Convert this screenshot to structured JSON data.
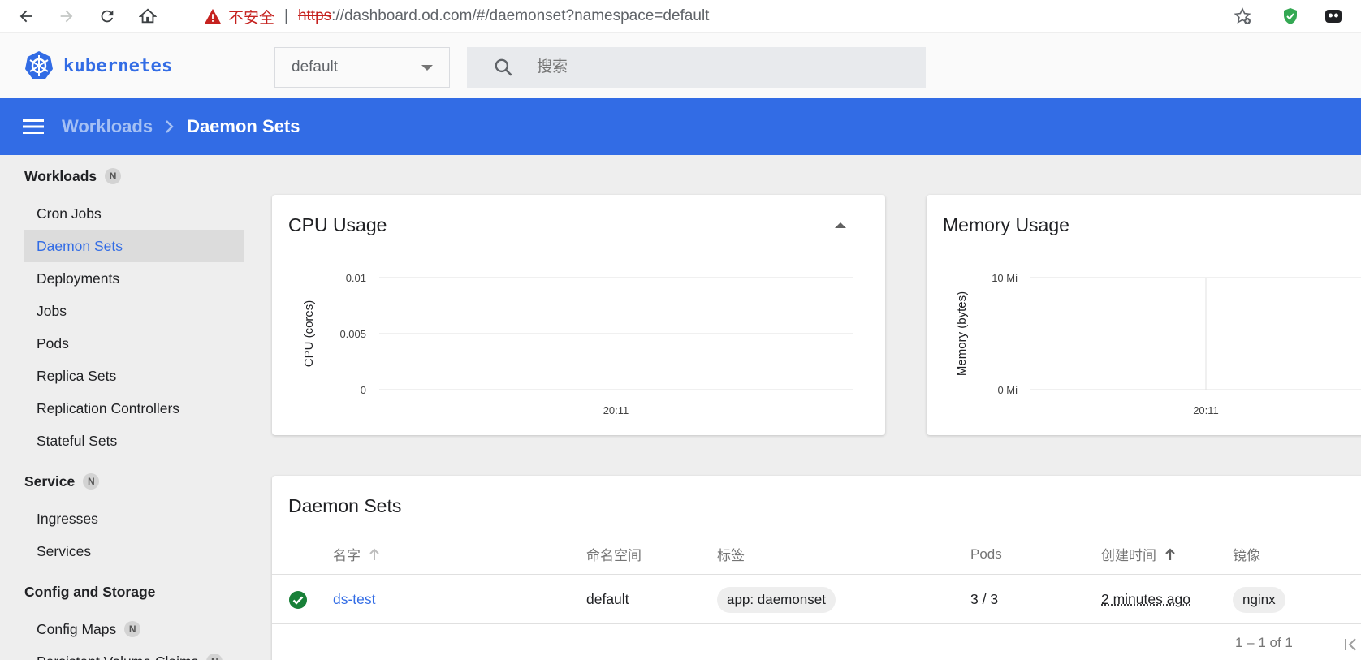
{
  "browser": {
    "security_label": "不安全",
    "url_scheme": "https",
    "url_rest": "://dashboard.od.com/#/daemonset?namespace=default"
  },
  "header": {
    "logo_text": "kubernetes",
    "namespace": "default",
    "search_placeholder": "搜索"
  },
  "toolbar": {
    "breadcrumb_parent": "Workloads",
    "breadcrumb_current": "Daemon Sets"
  },
  "sidebar": {
    "groups": [
      {
        "label": "Workloads",
        "badge": "N",
        "items": [
          "Cron Jobs",
          "Daemon Sets",
          "Deployments",
          "Jobs",
          "Pods",
          "Replica Sets",
          "Replication Controllers",
          "Stateful Sets"
        ]
      },
      {
        "label": "Service",
        "badge": "N",
        "items": [
          "Ingresses",
          "Services"
        ]
      },
      {
        "label": "Config and Storage",
        "badge": "",
        "items": [
          "Config Maps"
        ]
      }
    ],
    "config_maps_badge": "N",
    "partial_item": "Persistent Volume Claims",
    "partial_badge": "N"
  },
  "cpu_card": {
    "title": "CPU Usage"
  },
  "memory_card": {
    "title": "Memory Usage"
  },
  "chart_data": [
    {
      "type": "line",
      "title": "CPU Usage",
      "xlabel": "",
      "ylabel": "CPU (cores)",
      "x_ticks": [
        "20:11"
      ],
      "y_ticks": [
        "0",
        "0.005",
        "0.01"
      ],
      "ylim": [
        0,
        0.01
      ],
      "series": []
    },
    {
      "type": "line",
      "title": "Memory Usage",
      "xlabel": "",
      "ylabel": "Memory (bytes)",
      "x_ticks": [
        "20:11"
      ],
      "y_ticks": [
        "0 Mi",
        "10 Mi"
      ],
      "series": []
    }
  ],
  "daemon_sets": {
    "title": "Daemon Sets",
    "columns": {
      "name": "名字",
      "namespace": "命名空间",
      "labels": "标签",
      "pods": "Pods",
      "created": "创建时间",
      "images": "镜像"
    },
    "rows": [
      {
        "status": "running",
        "name": "ds-test",
        "namespace": "default",
        "labels": "app: daemonset",
        "pods": "3 / 3",
        "created": "2 minutes ago",
        "images": "nginx"
      }
    ],
    "pagination": "1 – 1 of 1"
  },
  "colors": {
    "brand": "#326ce5",
    "success": "#188038",
    "danger": "#c5221f"
  }
}
